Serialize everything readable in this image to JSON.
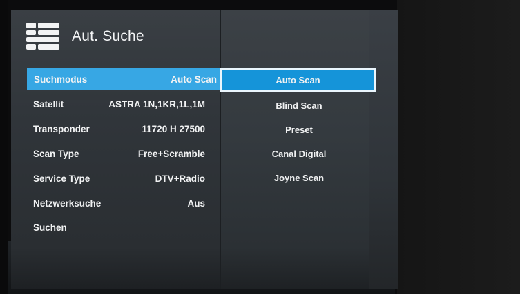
{
  "header": {
    "title": "Aut. Suche",
    "icon": "menu-list-icon"
  },
  "settings": [
    {
      "label": "Suchmodus",
      "value": "Auto Scan",
      "selected": true
    },
    {
      "label": "Satellit",
      "value": "ASTRA 1N,1KR,1L,1M",
      "selected": false
    },
    {
      "label": "Transponder",
      "value": "11720 H 27500",
      "selected": false
    },
    {
      "label": "Scan Type",
      "value": "Free+Scramble",
      "selected": false
    },
    {
      "label": "Service Type",
      "value": "DTV+Radio",
      "selected": false
    },
    {
      "label": "Netzwerksuche",
      "value": "Aus",
      "selected": false
    },
    {
      "label": "Suchen",
      "value": "",
      "selected": false
    }
  ],
  "options": [
    {
      "label": "Auto Scan",
      "selected": true
    },
    {
      "label": "Blind Scan",
      "selected": false
    },
    {
      "label": "Preset",
      "selected": false
    },
    {
      "label": "Canal Digital",
      "selected": false
    },
    {
      "label": "Joyne Scan",
      "selected": false
    }
  ],
  "colors": {
    "highlight": "#37a7e4",
    "option_highlight": "#1594d9",
    "panel": "#353a3f",
    "text": "#f1f2f3"
  }
}
